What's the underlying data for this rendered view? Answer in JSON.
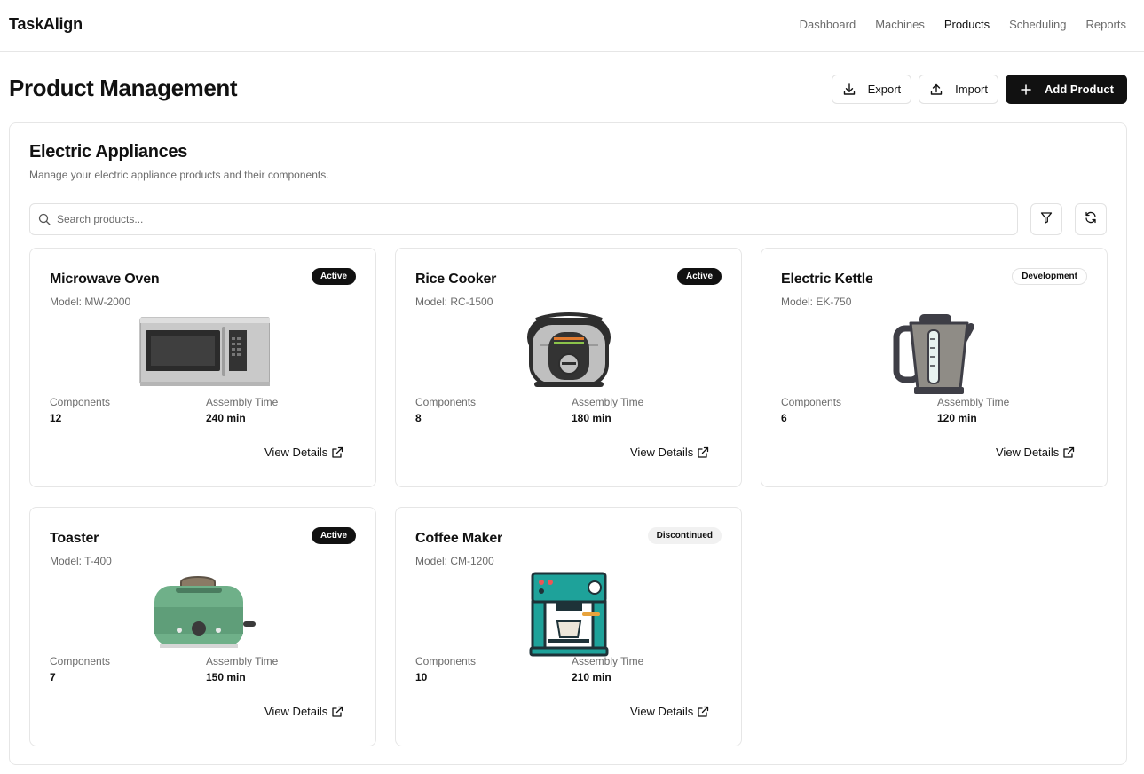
{
  "app": {
    "brand": "TaskAlign"
  },
  "nav": [
    {
      "label": "Dashboard"
    },
    {
      "label": "Machines"
    },
    {
      "label": "Products",
      "active": true
    },
    {
      "label": "Scheduling"
    },
    {
      "label": "Reports"
    }
  ],
  "page": {
    "title": "Product Management"
  },
  "actions": {
    "export_label": "Export",
    "import_label": "Import",
    "add_label": "Add Product"
  },
  "panel": {
    "title": "Electric Appliances",
    "subtitle": "Manage your electric appliance products and their components.",
    "search_placeholder": "Search products..."
  },
  "labels": {
    "components": "Components",
    "assembly": "Assembly Time",
    "view": "View Details"
  },
  "products": [
    {
      "name": "Microwave Oven",
      "model": "Model: MW-2000",
      "status": "Active",
      "components": "12",
      "assembly": "240 min",
      "image_icon": "microwave-icon"
    },
    {
      "name": "Rice Cooker",
      "model": "Model: RC-1500",
      "status": "Active",
      "components": "8",
      "assembly": "180 min",
      "image_icon": "rice-cooker-icon"
    },
    {
      "name": "Electric Kettle",
      "model": "Model: EK-750",
      "status": "Development",
      "components": "6",
      "assembly": "120 min",
      "image_icon": "kettle-icon"
    },
    {
      "name": "Toaster",
      "model": "Model: T-400",
      "status": "Active",
      "components": "7",
      "assembly": "150 min",
      "image_icon": "toaster-icon"
    },
    {
      "name": "Coffee Maker",
      "model": "Model: CM-1200",
      "status": "Discontinued",
      "components": "10",
      "assembly": "210 min",
      "image_icon": "coffee-maker-icon"
    }
  ],
  "colors": {
    "primary": "#111111",
    "muted_text": "#6b6b6b",
    "border": "#e6e6e6",
    "badge_discontinued": "#f1f1f1"
  }
}
